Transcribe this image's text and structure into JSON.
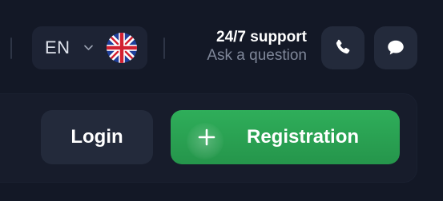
{
  "header": {
    "language": {
      "code": "EN",
      "flag_icon": "uk-flag-icon",
      "chevron_icon": "chevron-down-icon"
    },
    "support": {
      "title": "24/7 support",
      "subtitle": "Ask a question"
    },
    "phone_button": {
      "icon": "phone-icon"
    },
    "chat_button": {
      "icon": "chat-bubble-icon"
    }
  },
  "auth": {
    "login_label": "Login",
    "registration_label": "Registration",
    "registration_icon": "plus-icon"
  },
  "colors": {
    "background": "#131826",
    "panel": "#171c2b",
    "button_dark": "#232a3b",
    "accent_green": "#2fae5a",
    "muted_text": "#7f8799"
  }
}
